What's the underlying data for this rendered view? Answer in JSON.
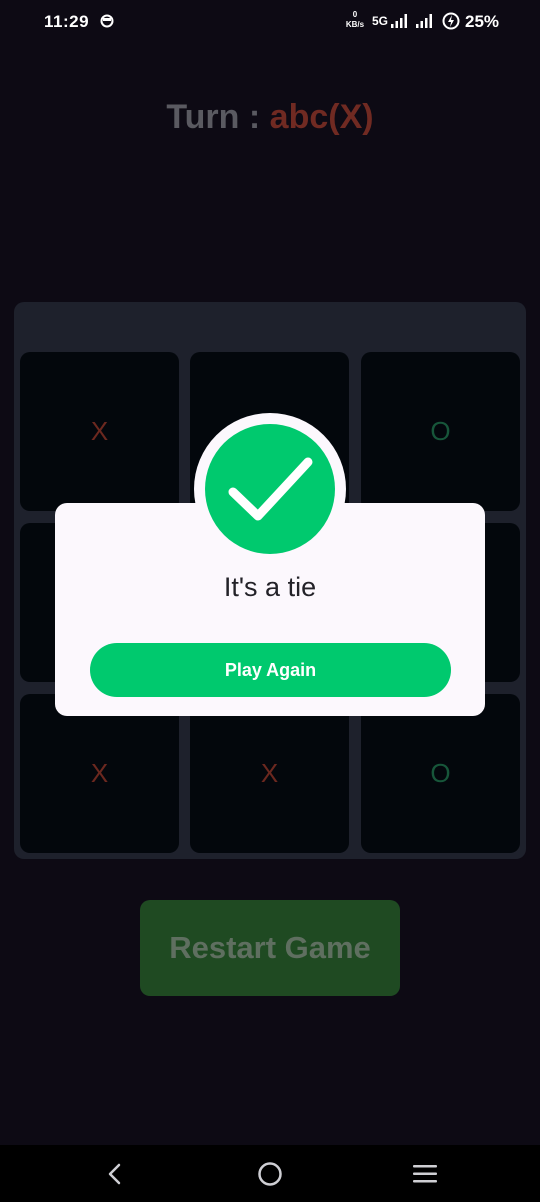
{
  "status_bar": {
    "time": "11:29",
    "speed_value": "0",
    "speed_unit": "KB/s",
    "network": "5G",
    "battery": "25%"
  },
  "turn": {
    "label": "Turn : ",
    "player": "abc(X)"
  },
  "board": {
    "cells": [
      "X",
      "",
      "O",
      "",
      "",
      "",
      "X",
      "X",
      "O"
    ]
  },
  "restart_label": "Restart Game",
  "dialog": {
    "message": "It's a tie",
    "button_label": "Play Again"
  },
  "colors": {
    "accent_green": "#00c96e",
    "x_mark": "#6b281f",
    "o_mark": "#17563a",
    "board_bg": "#1e212c",
    "cell_bg": "#03070c"
  },
  "icons": {
    "dialog_badge": "check-icon",
    "nav_back": "back-icon",
    "nav_home": "home-icon",
    "nav_recents": "menu-icon"
  }
}
